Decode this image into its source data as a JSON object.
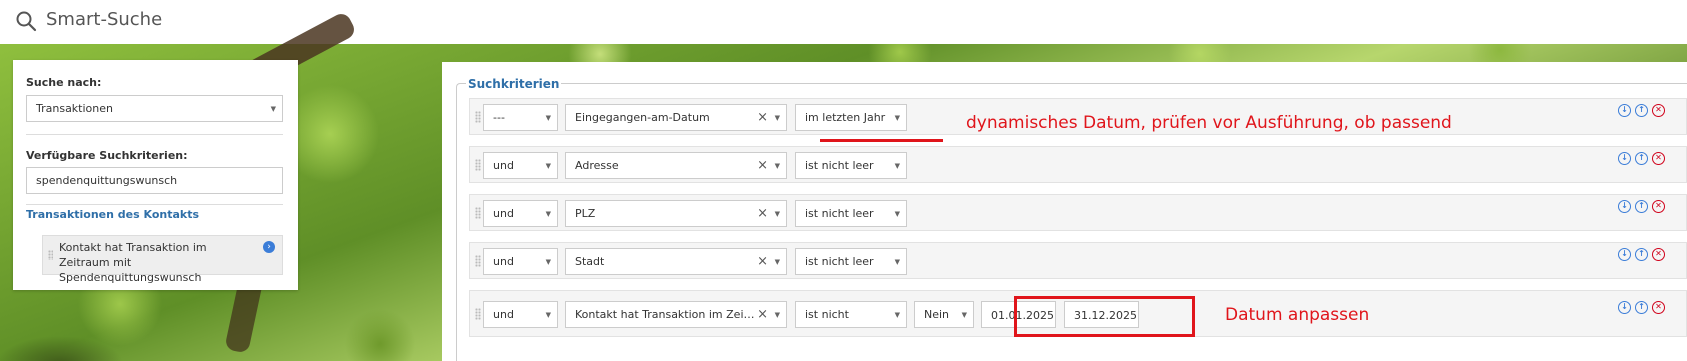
{
  "header": {
    "title": "Smart-Suche",
    "icon": "search-icon"
  },
  "left_panel": {
    "search_for_label": "Suche nach:",
    "search_for_value": "Transaktionen",
    "available_label": "Verfügbare Suchkriterien:",
    "filter_value": "spendenquittungswunsch",
    "group_link": "Transaktionen des Kontakts",
    "item_label": "Kontakt hat Transaktion im Zeitraum mit Spendenquittungswunsch"
  },
  "criteria": {
    "legend": "Suchkriterien",
    "rows": [
      {
        "connector": "---",
        "field": "Eingegangen-am-Datum",
        "operator": "im letzten Jahr"
      },
      {
        "connector": "und",
        "field": "Adresse",
        "operator": "ist nicht leer"
      },
      {
        "connector": "und",
        "field": "PLZ",
        "operator": "ist nicht leer"
      },
      {
        "connector": "und",
        "field": "Stadt",
        "operator": "ist nicht leer"
      },
      {
        "connector": "und",
        "field": "Kontakt hat Transaktion im Zeitraum ...",
        "operator": "ist nicht",
        "value": "Nein",
        "date_from": "01.01.2025",
        "date_to": "31.12.2025"
      }
    ]
  },
  "annotations": {
    "dynamic_date": "dynamisches Datum, prüfen vor Ausführung, ob passend",
    "adjust_date": "Datum anpassen",
    "highlight_color": "#e0151b"
  },
  "colors": {
    "link": "#2f6fa8",
    "action_blue": "#3b7dd8",
    "delete_red": "#d0021b"
  }
}
